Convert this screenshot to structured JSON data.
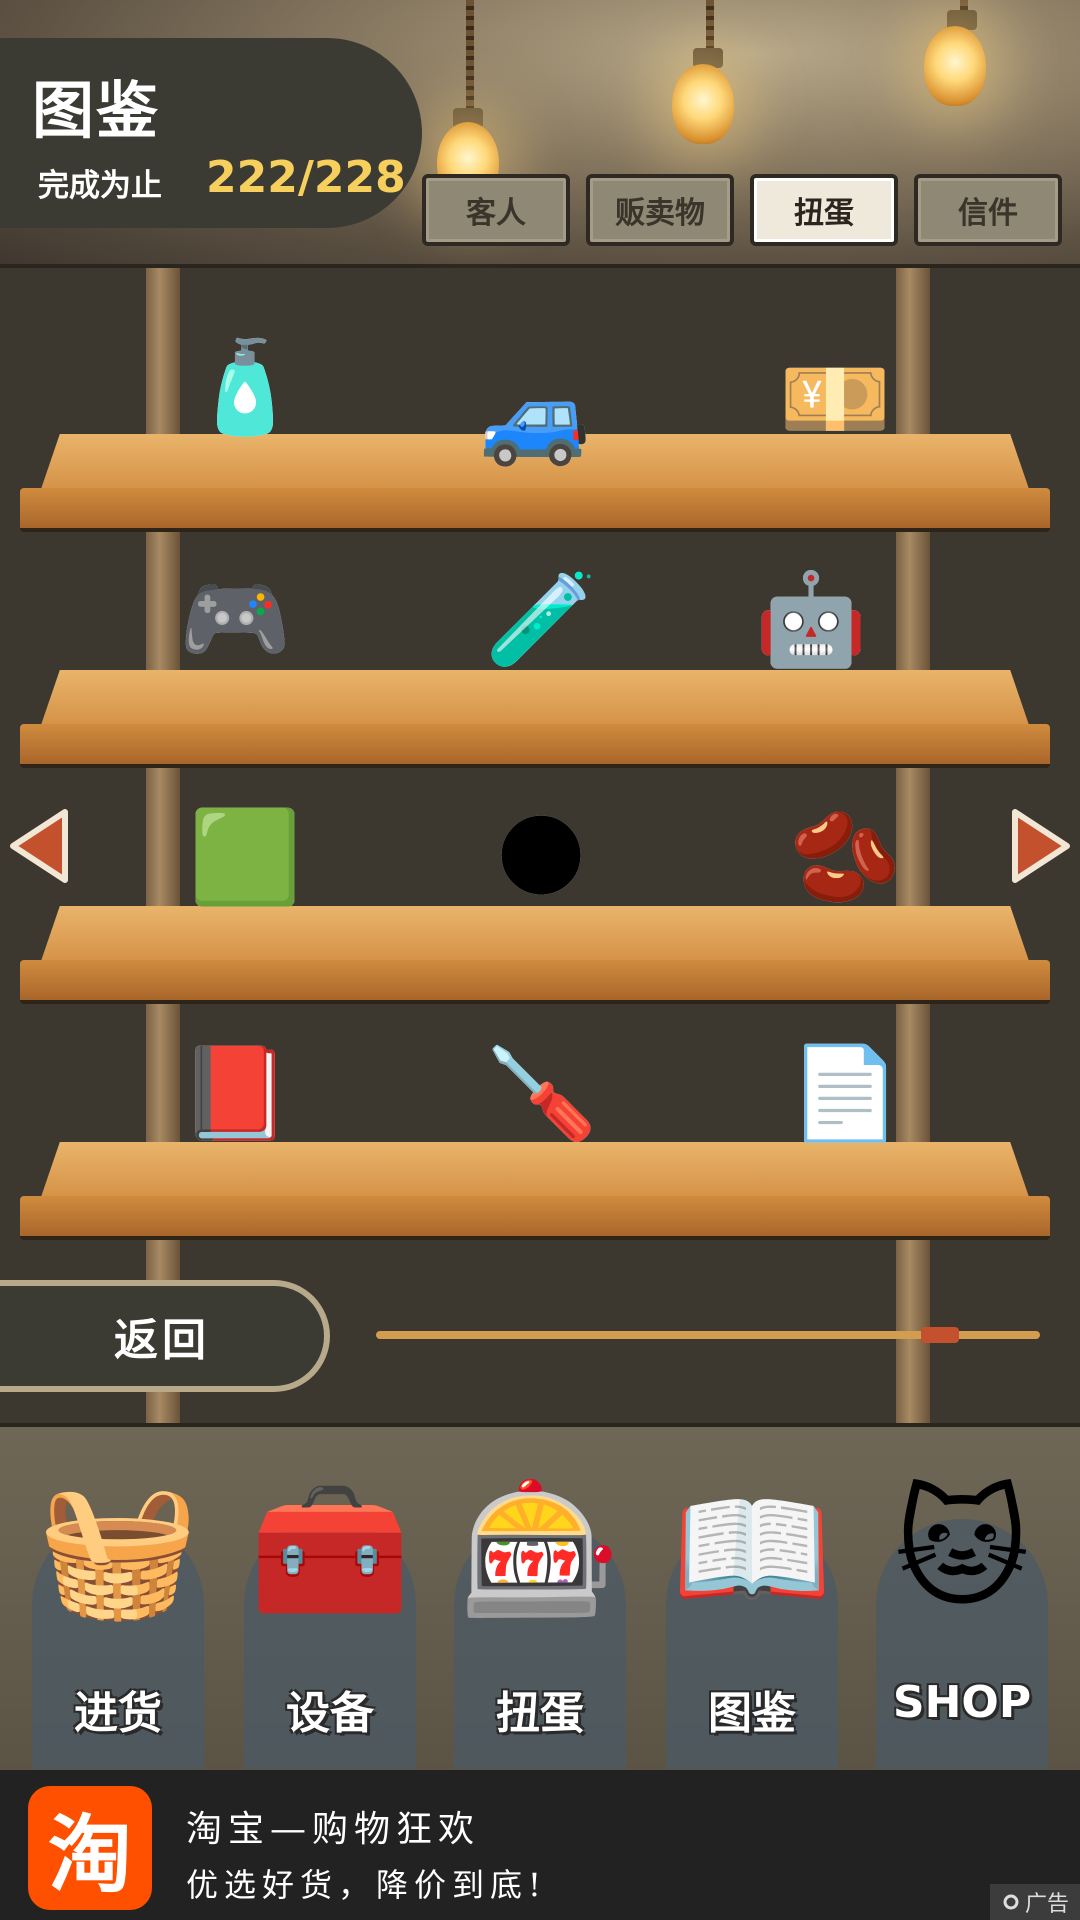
{
  "header": {
    "title": "图鉴",
    "progress_label": "完成为止",
    "progress_count": "222/228",
    "tabs": [
      {
        "label": "客人",
        "active": false
      },
      {
        "label": "贩卖物",
        "active": false
      },
      {
        "label": "扭蛋",
        "active": true
      },
      {
        "label": "信件",
        "active": false
      }
    ]
  },
  "shelves": [
    {
      "items": [
        {
          "icon": "perfume-bottle-icon",
          "glyph": "🧴"
        },
        {
          "icon": "toy-car-icon",
          "glyph": "🚙"
        },
        {
          "icon": "banknote-icon",
          "glyph": "💴"
        }
      ]
    },
    {
      "items": [
        {
          "icon": "handheld-game-icon",
          "glyph": "🎮"
        },
        {
          "icon": "spilled-slime-can-icon",
          "glyph": "🧪"
        },
        {
          "icon": "robot-toy-icon",
          "glyph": "🤖"
        }
      ]
    },
    {
      "items": [
        {
          "icon": "green-stapler-icon",
          "glyph": "🟩"
        },
        {
          "icon": "moon-rock-icon",
          "glyph": "🌑"
        },
        {
          "icon": "seeds-icon",
          "glyph": "🫘"
        }
      ]
    },
    {
      "items": [
        {
          "icon": "notebook-keychain-icon",
          "glyph": "📕"
        },
        {
          "icon": "screwdriver-icon",
          "glyph": "🪛"
        },
        {
          "icon": "torn-paper-icon",
          "glyph": "📄"
        }
      ]
    }
  ],
  "navigation": {
    "prev_icon": "left-arrow-icon",
    "next_icon": "right-arrow-icon",
    "back_label": "返回",
    "page_position": 0.87
  },
  "bottom_nav": [
    {
      "label": "进货",
      "icon": "goods-basket-icon",
      "glyph": "🧺"
    },
    {
      "label": "设备",
      "icon": "toolbox-icon",
      "glyph": "🧰"
    },
    {
      "label": "扭蛋",
      "icon": "gacha-machine-icon",
      "glyph": "🎰"
    },
    {
      "label": "图鉴",
      "icon": "open-book-icon",
      "glyph": "📖"
    },
    {
      "label": "SHOP",
      "icon": "lucky-cat-icon",
      "glyph": "🐱"
    }
  ],
  "ad": {
    "logo_char": "淘",
    "title": "淘宝—购物狂欢",
    "subtitle": "优选好货，降价到底!",
    "tag": "广告"
  },
  "colors": {
    "accent_yellow": "#f7cf5c",
    "arrow_red": "#c3512e",
    "ad_orange": "#ff5000"
  }
}
